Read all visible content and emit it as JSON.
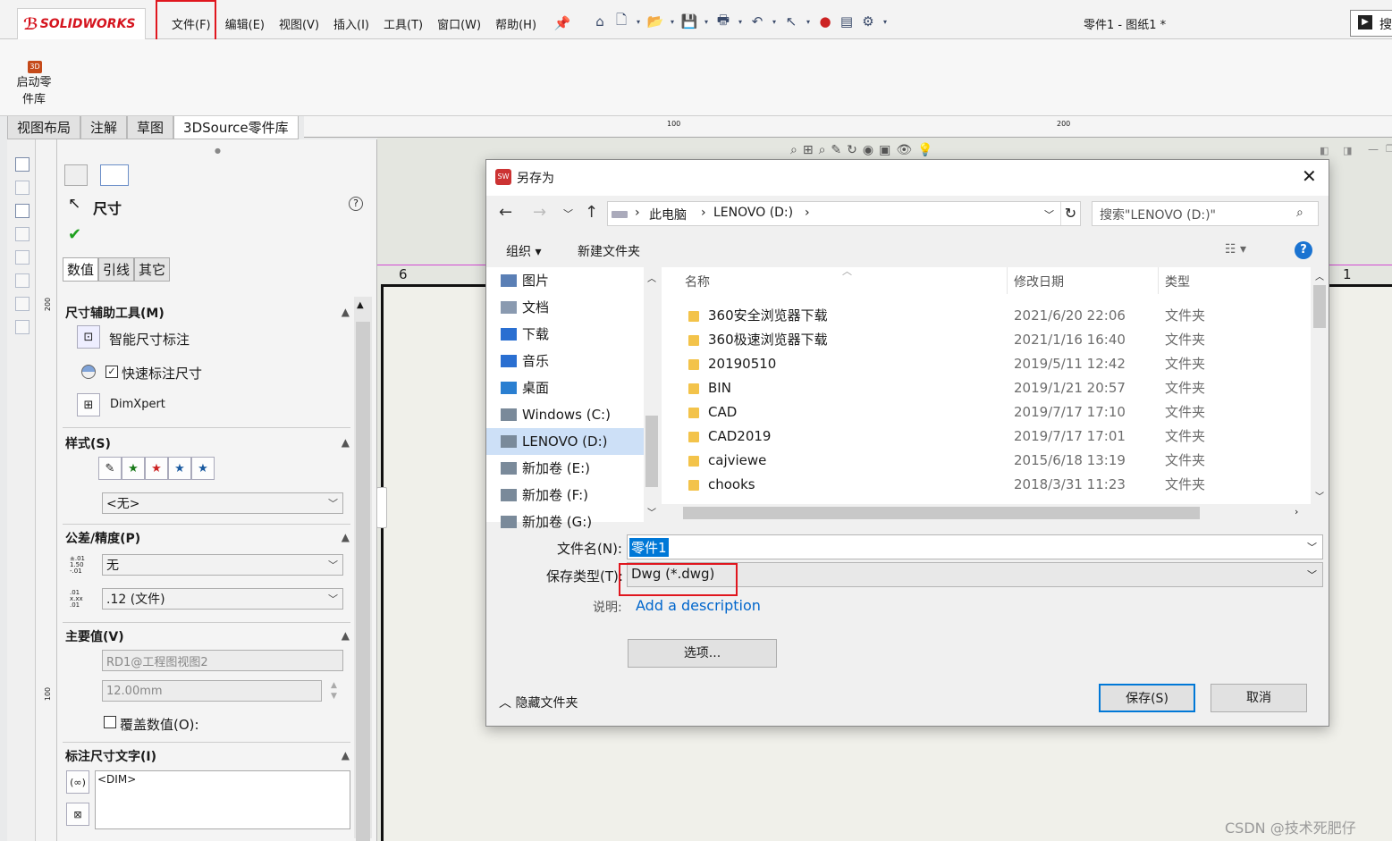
{
  "app": {
    "logo": "SOLIDWORKS",
    "doc_title": "零件1 - 图纸1 *",
    "search_glyph": "搜"
  },
  "menu": [
    "文件(F)",
    "编辑(E)",
    "视图(V)",
    "插入(I)",
    "工具(T)",
    "窗口(W)",
    "帮助(H)"
  ],
  "ribbon": {
    "start_library": "启动零件库",
    "badge": "3D"
  },
  "tabs": [
    "视图布局",
    "注解",
    "草图",
    "3DSource零件库"
  ],
  "ruler": {
    "marks": [
      "100",
      "200"
    ],
    "vmarks": [
      "200",
      "100"
    ]
  },
  "pm": {
    "title": "尺寸",
    "help": "?",
    "subtabs": [
      "数值",
      "引线",
      "其它"
    ],
    "dim_tools": {
      "header": "尺寸辅助工具(M)",
      "smart": "智能尺寸标注",
      "quick": "快速标注尺寸",
      "dimxpert": "DimXpert"
    },
    "style": {
      "header": "样式(S)",
      "value": "<无>"
    },
    "tolerance": {
      "header": "公差/精度(P)",
      "tol_value": "无",
      "precision_value": ".12 (文件)"
    },
    "primary": {
      "header": "主要值(V)",
      "ref": "RD1@工程图视图2",
      "value": "12.00mm",
      "override": "覆盖数值(O):"
    },
    "dimtext": {
      "header": "标注尺寸文字(I)",
      "text": "<DIM>"
    }
  },
  "canvas": {
    "zone_left": "6",
    "zone_right": "1"
  },
  "dialog": {
    "title": "另存为",
    "path": [
      "此电脑",
      "LENOVO (D:)"
    ],
    "search_placeholder": "搜索\"LENOVO (D:)\"",
    "organize": "组织 ▾",
    "new_folder": "新建文件夹",
    "nav": [
      {
        "label": "图片",
        "color": "#5a7fb5"
      },
      {
        "label": "文档",
        "color": "#8a9ab0"
      },
      {
        "label": "下载",
        "color": "#2a6fd1"
      },
      {
        "label": "音乐",
        "color": "#2a6fd1"
      },
      {
        "label": "桌面",
        "color": "#2a7fd1"
      },
      {
        "label": "Windows (C:)",
        "color": "#7a8a9a"
      },
      {
        "label": "LENOVO (D:)",
        "color": "#7a8a9a"
      },
      {
        "label": "新加卷 (E:)",
        "color": "#7a8a9a"
      },
      {
        "label": "新加卷 (F:)",
        "color": "#7a8a9a"
      },
      {
        "label": "新加卷 (G:)",
        "color": "#7a8a9a"
      }
    ],
    "columns": [
      "名称",
      "修改日期",
      "类型"
    ],
    "files": [
      {
        "name": "360安全浏览器下载",
        "date": "2021/6/20 22:06",
        "type": "文件夹"
      },
      {
        "name": "360极速浏览器下载",
        "date": "2021/1/16 16:40",
        "type": "文件夹"
      },
      {
        "name": "20190510",
        "date": "2019/5/11 12:42",
        "type": "文件夹"
      },
      {
        "name": "BIN",
        "date": "2019/1/21 20:57",
        "type": "文件夹"
      },
      {
        "name": "CAD",
        "date": "2019/7/17 17:10",
        "type": "文件夹"
      },
      {
        "name": "CAD2019",
        "date": "2019/7/17 17:01",
        "type": "文件夹"
      },
      {
        "name": "cajviewe",
        "date": "2015/6/18 13:19",
        "type": "文件夹"
      },
      {
        "name": "chooks",
        "date": "2018/3/31 11:23",
        "type": "文件夹"
      }
    ],
    "filename_label": "文件名(N):",
    "filename": "零件1",
    "savetype_label": "保存类型(T):",
    "savetype": "Dwg (*.dwg)",
    "desc_label": "说明:",
    "desc_link": "Add a description",
    "options": "选项...",
    "hide_folders": "隐藏文件夹",
    "save": "保存(S)",
    "cancel": "取消"
  },
  "watermark": "CSDN @技术死肥仔",
  "colors": {
    "accent": "#0066cc",
    "highlight": "#e0161e",
    "selection": "#cde0f7"
  }
}
